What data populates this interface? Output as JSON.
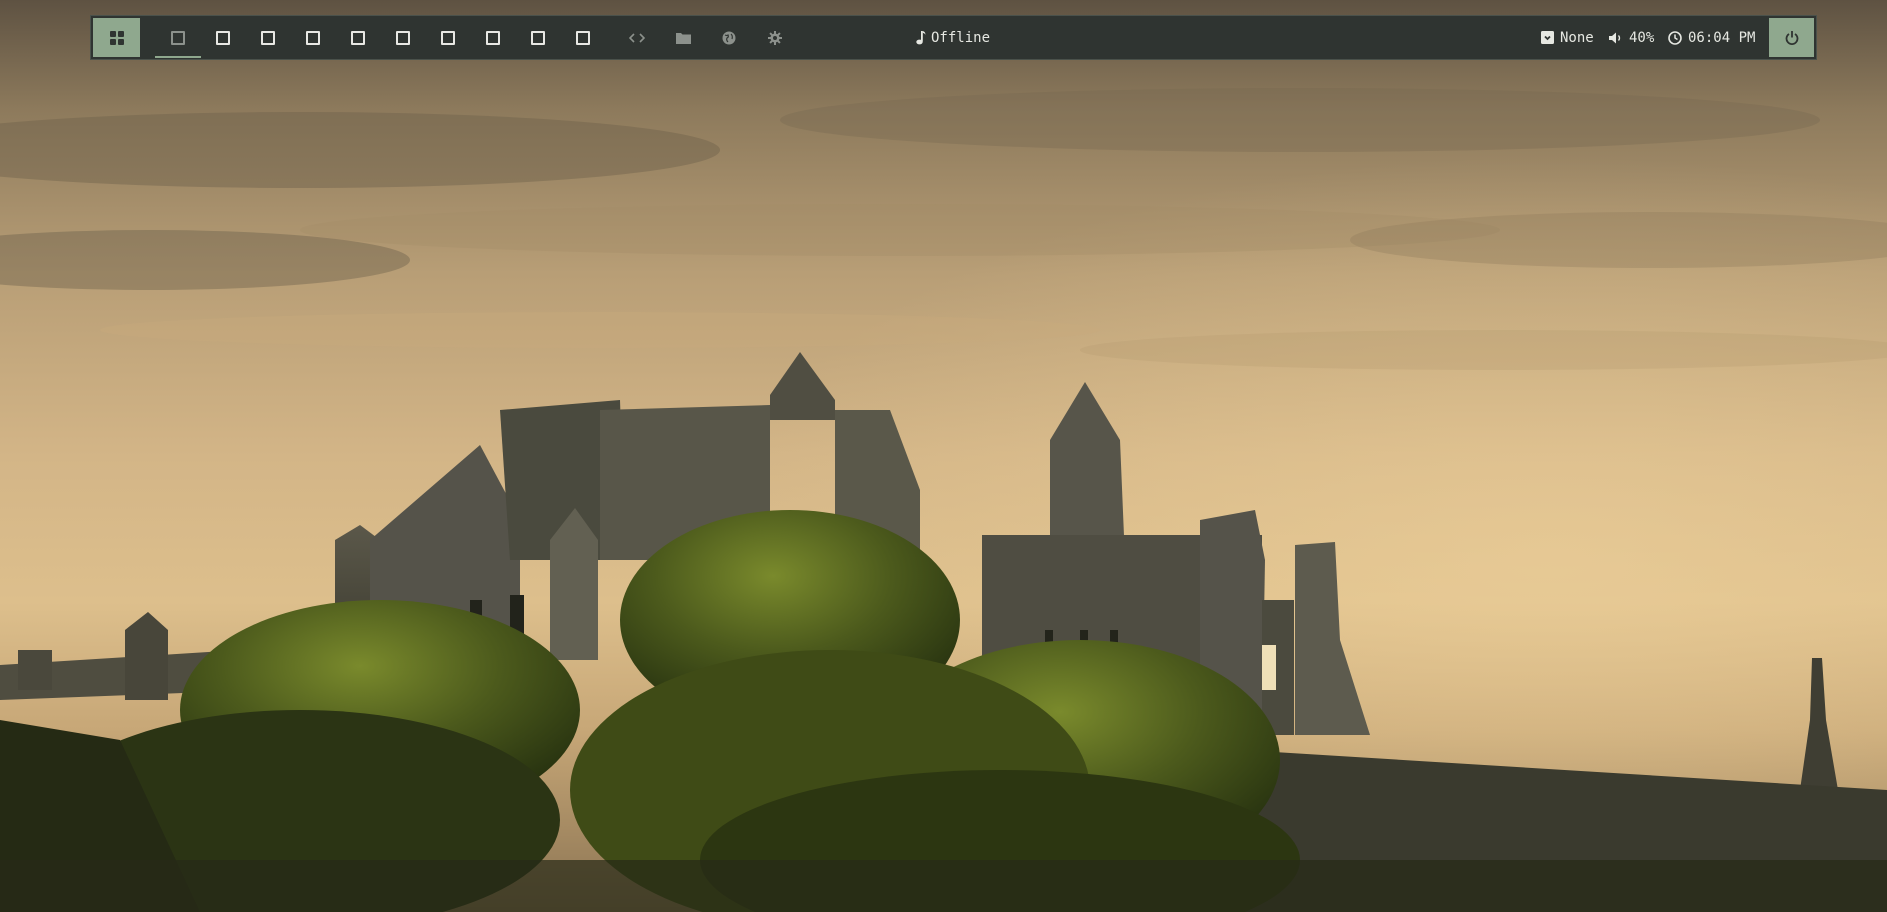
{
  "desktop": {
    "wallpaper": "castle-ruins-at-sunset",
    "colors": {
      "bar_background": "#2f3431",
      "accent": "#8fa88e",
      "text": "#e6e8e2",
      "dim_icon": "#8c918c"
    }
  },
  "bar": {
    "launcher_icon": "grid-icon",
    "workspaces": [
      {
        "index": 1,
        "active": true
      },
      {
        "index": 2,
        "active": false
      },
      {
        "index": 3,
        "active": false
      },
      {
        "index": 4,
        "active": false
      },
      {
        "index": 5,
        "active": false
      },
      {
        "index": 6,
        "active": false
      },
      {
        "index": 7,
        "active": false
      },
      {
        "index": 8,
        "active": false
      },
      {
        "index": 9,
        "active": false
      },
      {
        "index": 10,
        "active": false
      }
    ],
    "apps": [
      "code-icon",
      "folder-icon",
      "globe-icon",
      "gear-icon"
    ],
    "music": {
      "icon": "music-note-icon",
      "text": "Offline"
    },
    "updates": {
      "icon": "package-icon",
      "text": "None"
    },
    "volume": {
      "icon": "speaker-icon",
      "text": "40%"
    },
    "clock": {
      "icon": "clock-icon",
      "text": "06:04 PM"
    },
    "power_icon": "power-icon"
  }
}
